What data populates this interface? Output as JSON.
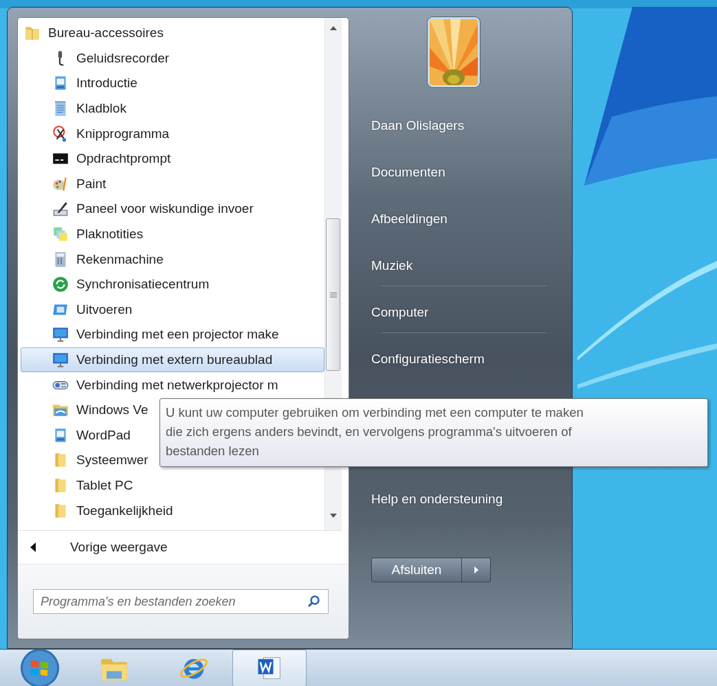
{
  "start_menu": {
    "programs": {
      "label": "Bureau-accessoires",
      "children": [
        {
          "label": "Geluidsrecorder",
          "kind": "app",
          "selected": false
        },
        {
          "label": "Introductie",
          "kind": "app",
          "selected": false
        },
        {
          "label": "Kladblok",
          "kind": "app",
          "selected": false
        },
        {
          "label": "Knipprogramma",
          "kind": "app",
          "selected": false
        },
        {
          "label": "Opdrachtprompt",
          "kind": "app",
          "selected": false
        },
        {
          "label": "Paint",
          "kind": "app",
          "selected": false
        },
        {
          "label": "Paneel voor wiskundige invoer",
          "kind": "app",
          "selected": false
        },
        {
          "label": "Plaknotities",
          "kind": "app",
          "selected": false
        },
        {
          "label": "Rekenmachine",
          "kind": "app",
          "selected": false
        },
        {
          "label": "Synchronisatiecentrum",
          "kind": "app",
          "selected": false
        },
        {
          "label": "Uitvoeren",
          "kind": "app",
          "selected": false
        },
        {
          "label": "Verbinding met een projector make",
          "kind": "app",
          "selected": false
        },
        {
          "label": "Verbinding met extern bureaublad",
          "kind": "app",
          "selected": true
        },
        {
          "label": "Verbinding met netwerkprojector m",
          "kind": "app",
          "selected": false
        },
        {
          "label": "Windows Ve",
          "kind": "app",
          "selected": false
        },
        {
          "label": "WordPad",
          "kind": "app",
          "selected": false
        },
        {
          "label": "Systeemwer",
          "kind": "folder",
          "selected": false
        },
        {
          "label": "Tablet PC",
          "kind": "folder",
          "selected": false
        },
        {
          "label": "Toegankelijkheid",
          "kind": "folder",
          "selected": false
        }
      ]
    },
    "back": {
      "label": "Vorige weergave"
    },
    "search": {
      "placeholder": "Programma's en bestanden zoeken"
    },
    "places": [
      [
        "Daan Olislagers",
        "Documenten",
        "Afbeeldingen",
        "Muziek"
      ],
      [
        "Computer"
      ],
      [
        "Configuratiescherm",
        "Help en ondersteuning"
      ]
    ],
    "shutdown": {
      "label": "Afsluiten"
    }
  },
  "tooltip": {
    "lines": [
      "U kunt uw computer gebruiken om verbinding met een computer te maken",
      "die zich ergens anders bevindt, en vervolgens programma's uitvoeren of",
      "bestanden lezen"
    ]
  }
}
